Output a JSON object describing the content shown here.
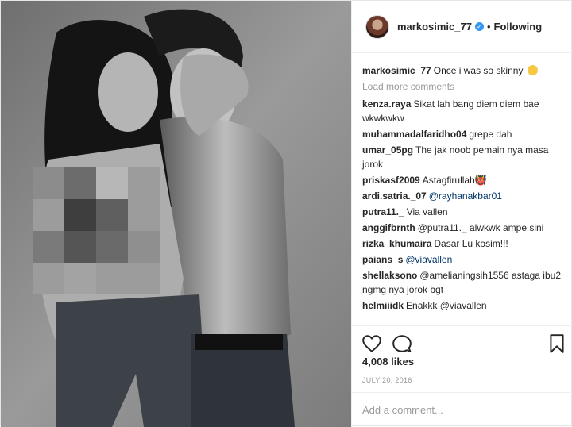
{
  "header": {
    "username": "markosimic_77",
    "verified": true,
    "separator": "•",
    "follow_label": "Following"
  },
  "caption": {
    "username": "markosimic_77",
    "text": "Once i was so skinny",
    "emoji": "grimacing-face-emoji"
  },
  "load_more_label": "Load more comments",
  "comments": [
    {
      "user": "kenza.raya",
      "text": "Sikat lah bang diem diem bae wkwkwkw"
    },
    {
      "user": "muhammadalfaridho04",
      "text": "grepe dah"
    },
    {
      "user": "umar_05pg",
      "text": "The jak noob pemain nya masa jorok"
    },
    {
      "user": "priskasf2009",
      "text": "Astagfirullah👹"
    },
    {
      "user": "ardi.satria._07",
      "text": "@rayhanakbar01"
    },
    {
      "user": "putra11._",
      "text": "Via vallen"
    },
    {
      "user": "anggifbrnth",
      "text": "@putra11._ alwkwk ampe sini"
    },
    {
      "user": "rizka_khumaira",
      "text": "Dasar Lu kosim!!!"
    },
    {
      "user": "paians_s",
      "text": "@viavallen"
    },
    {
      "user": "shellaksono",
      "text": "@amelianingsih1556 astaga ibu2 ngmg nya jorok bgt"
    },
    {
      "user": "helmiiidk",
      "text": "Enakkk @viavallen"
    }
  ],
  "actions": {
    "like_icon": "heart-icon",
    "comment_icon": "comment-icon",
    "save_icon": "bookmark-icon"
  },
  "likes_text": "4,008 likes",
  "date_text": "JULY 20, 2016",
  "add_comment_placeholder": "Add a comment...",
  "colors": {
    "link": "#003569",
    "verified": "#3897f0",
    "muted": "#999999"
  }
}
